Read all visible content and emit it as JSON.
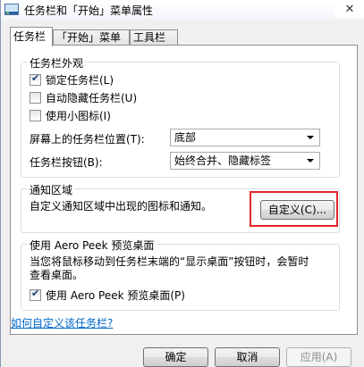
{
  "window": {
    "title": "任务栏和「开始」菜单属性",
    "close_glyph": "✕"
  },
  "tabs": [
    {
      "label": "任务栏",
      "active": true
    },
    {
      "label": "「开始」菜单",
      "active": false
    },
    {
      "label": "工具栏",
      "active": false
    }
  ],
  "appearance": {
    "title": "任务栏外观",
    "lock_taskbar": {
      "label": "锁定任务栏(L)",
      "checked": true
    },
    "auto_hide": {
      "label": "自动隐藏任务栏(U)",
      "checked": false
    },
    "small_icons": {
      "label": "使用小图标(I)",
      "checked": false
    },
    "position_label": "屏幕上的任务栏位置(T):",
    "position_value": "底部",
    "buttons_label": "任务栏按钮(B):",
    "buttons_value": "始终合并、隐藏标签"
  },
  "notification": {
    "title": "通知区域",
    "description": "自定义通知区域中出现的图标和通知。",
    "customize_button": "自定义(C)...",
    "highlight_color": "#e0262b"
  },
  "aero_peek": {
    "title": "使用 Aero Peek 预览桌面",
    "description_line1": "当您将鼠标移动到任务栏末端的“显示桌面”按钮时，会暂时",
    "description_line2": "查看桌面。",
    "checkbox": {
      "label": "使用 Aero Peek 预览桌面(P)",
      "checked": true
    }
  },
  "help_link": "如何自定义该任务栏?",
  "footer": {
    "ok": "确定",
    "cancel": "取消",
    "apply": "应用(A)"
  }
}
